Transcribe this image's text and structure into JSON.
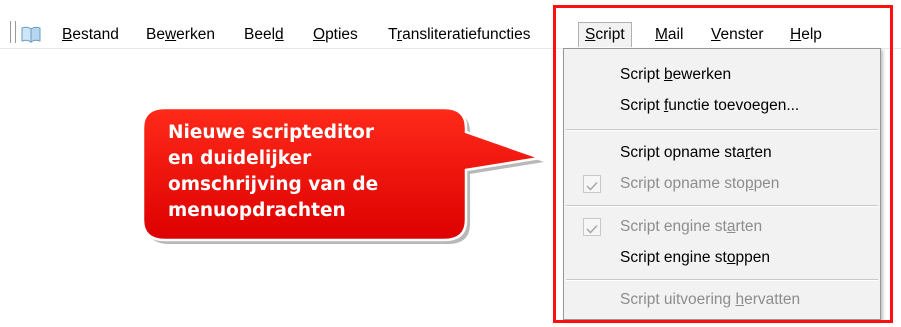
{
  "menubar": {
    "app_icon": "book-icon",
    "items": [
      {
        "label": "Bestand",
        "accesskey": "B"
      },
      {
        "label": "Bewerken",
        "accesskey": "w"
      },
      {
        "label": "Beeld",
        "accesskey": "d"
      },
      {
        "label": "Opties",
        "accesskey": "O"
      },
      {
        "label": "Transliteratiefuncties",
        "accesskey": "r"
      },
      {
        "label": "Script",
        "accesskey": "S"
      },
      {
        "label": "Mail",
        "accesskey": "M"
      },
      {
        "label": "Venster",
        "accesskey": "V"
      },
      {
        "label": "Help",
        "accesskey": "H"
      }
    ]
  },
  "script_menu": {
    "items": [
      {
        "label": "Script bewerken",
        "enabled": true,
        "checked": false
      },
      {
        "label": "Script functie toevoegen...",
        "enabled": true,
        "checked": false
      },
      {
        "label": "Script opname starten",
        "enabled": true,
        "checked": false
      },
      {
        "label": "Script opname stoppen",
        "enabled": false,
        "checked": true
      },
      {
        "label": "Script engine starten",
        "enabled": false,
        "checked": true
      },
      {
        "label": "Script engine stoppen",
        "enabled": true,
        "checked": false
      },
      {
        "label": "Script uitvoering hervatten",
        "enabled": false,
        "checked": false
      }
    ]
  },
  "callout": {
    "lines": [
      "Nieuwe scripteditor",
      "en duidelijker",
      "omschrijving van de",
      "menuopdrachten"
    ],
    "fill_color": "#ee0000",
    "highlight_color": "#ff1010"
  }
}
